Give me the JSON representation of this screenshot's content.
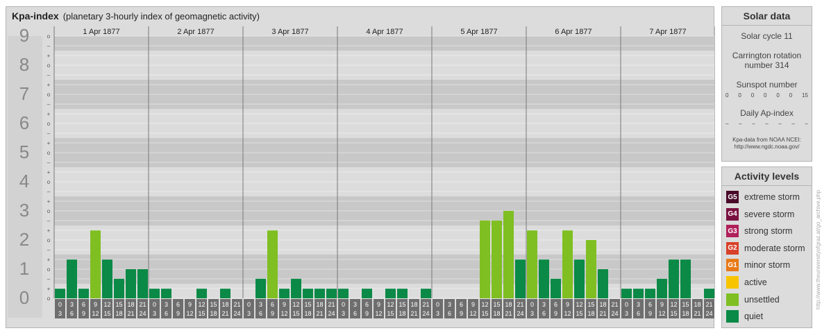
{
  "header": {
    "title": "Kpa-index",
    "subtitle": "(planetary 3-hourly index of geomagnetic activity)"
  },
  "chart_data": {
    "type": "bar",
    "title": "Kpa-index",
    "subtitle": "(planetary 3-hourly index of geomagnetic activity)",
    "ylim": [
      0,
      9
    ],
    "y_major_ticks": [
      "0",
      "1",
      "2",
      "3",
      "4",
      "5",
      "6",
      "7",
      "8",
      "9"
    ],
    "y_minor_ticks": [
      "o",
      "+",
      "–",
      "o",
      "+",
      "–",
      "o",
      "+",
      "–",
      "o",
      "+",
      "–",
      "o",
      "+",
      "–",
      "o",
      "+",
      "–",
      "o",
      "+",
      "–",
      "o",
      "+",
      "–",
      "o",
      "+",
      "–",
      "o"
    ],
    "days": [
      "1 Apr 1877",
      "2 Apr 1877",
      "3 Apr 1877",
      "4 Apr 1877",
      "5 Apr 1877",
      "6 Apr 1877",
      "7 Apr 1877"
    ],
    "interval_start": [
      "0",
      "3",
      "6",
      "9",
      "12",
      "15",
      "18",
      "21"
    ],
    "interval_end": [
      "3",
      "6",
      "9",
      "12",
      "15",
      "18",
      "21",
      "24"
    ],
    "values": [
      [
        0.33,
        1.33,
        0.33,
        2.33,
        1.33,
        0.67,
        1.0,
        1.0
      ],
      [
        0.33,
        0.33,
        0,
        0,
        0.33,
        0,
        0.33,
        0
      ],
      [
        0,
        0.67,
        2.33,
        0.33,
        0.67,
        0.33,
        0.33,
        0.33
      ],
      [
        0.33,
        0,
        0.33,
        0,
        0.33,
        0.33,
        0,
        0.33
      ],
      [
        0,
        0,
        0,
        0,
        2.67,
        2.67,
        3.0,
        1.33
      ],
      [
        2.33,
        1.33,
        0.67,
        2.33,
        1.33,
        2.0,
        1.0
      ],
      [
        0.33,
        0.33,
        0.33,
        0.67,
        1.33,
        1.33,
        0,
        0.33
      ]
    ],
    "colors": {
      "quiet": "#0a8a46",
      "unsettled": "#7fbf22",
      "background_dark": "#c8c8c8",
      "background_light": "#dcdcdc"
    },
    "grid": true
  },
  "solar": {
    "heading": "Solar data",
    "cycle": "Solar cycle 11",
    "carrington_line1": "Carrington rotation",
    "carrington_line2": "number 314",
    "sunspot_label": "Sunspot number",
    "sunspot_values": [
      "0",
      "0",
      "0",
      "0",
      "0",
      "0",
      "15"
    ],
    "ap_label": "Daily Ap-index",
    "ap_values": [
      "–",
      "–",
      "–",
      "–",
      "–",
      "–",
      "–"
    ],
    "source_line1": "Kpa-data from NOAA NCEI:",
    "source_line2": "http://www.ngdc.noaa.gov/"
  },
  "levels": {
    "heading": "Activity levels",
    "items": [
      {
        "badge": "G5",
        "label": "extreme storm",
        "color": "#4a0a2a"
      },
      {
        "badge": "G4",
        "label": "severe storm",
        "color": "#7a1040"
      },
      {
        "badge": "G3",
        "label": "strong storm",
        "color": "#b0205a"
      },
      {
        "badge": "G2",
        "label": "moderate storm",
        "color": "#d8402a"
      },
      {
        "badge": "G1",
        "label": "minor storm",
        "color": "#e87a18"
      },
      {
        "badge": "",
        "label": "active",
        "color": "#f8c400"
      },
      {
        "badge": "",
        "label": "unsettled",
        "color": "#7fbf22"
      },
      {
        "badge": "",
        "label": "quiet",
        "color": "#0a8a46"
      }
    ]
  },
  "watermark": "http://www.theuniversityofgraz.at/go_archive.php"
}
